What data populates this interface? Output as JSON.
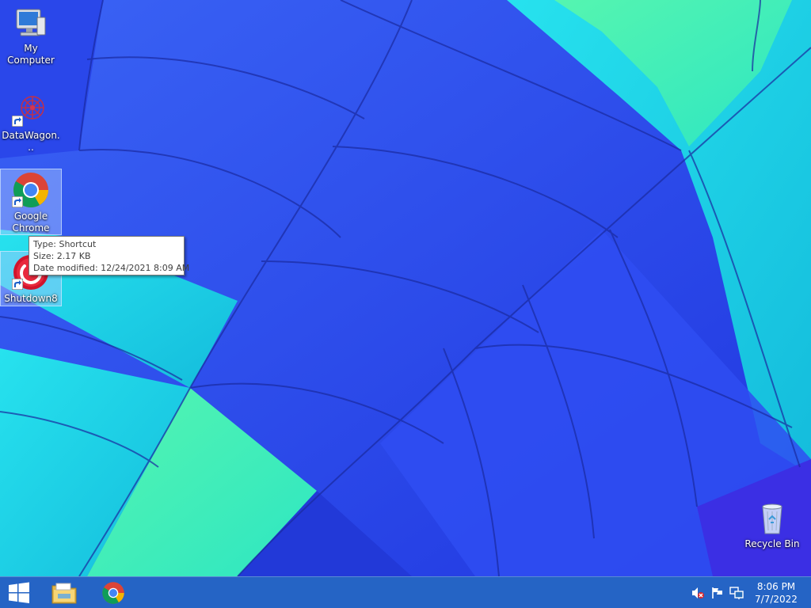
{
  "desktop": {
    "icons": [
      {
        "label": "My Computer"
      },
      {
        "label": "DataWagon..."
      },
      {
        "label": "Google Chrome"
      },
      {
        "label": "Shutdown8"
      },
      {
        "label": "Recycle Bin"
      }
    ]
  },
  "tooltip": {
    "type_line": "Type: Shortcut",
    "size_line": "Size: 2.17 KB",
    "date_line": "Date modified: 12/24/2021 8:09 AM"
  },
  "taskbar": {
    "pinned": [
      "start-icon",
      "file-explorer-icon",
      "chrome-icon"
    ],
    "tray": [
      "speaker-muted-icon",
      "action-center-flag-icon",
      "network-icon"
    ]
  },
  "clock": {
    "time": "8:06 PM",
    "date": "7/7/2022"
  },
  "colors": {
    "wallpaper_blue": "#2a4ff0",
    "wallpaper_cyan": "#19d3e6",
    "wallpaper_green": "#3ff0a6",
    "taskbar": "#286ebe"
  }
}
